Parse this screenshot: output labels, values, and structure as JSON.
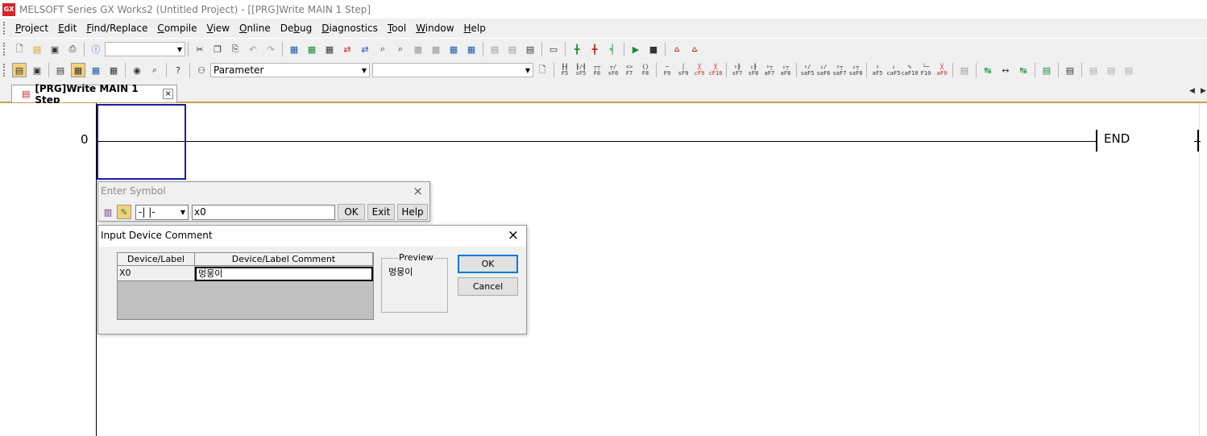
{
  "window": {
    "app_icon_text": "GX",
    "title": "MELSOFT Series GX Works2 (Untitled Project) - [[PRG]Write MAIN 1 Step]"
  },
  "menu": [
    {
      "label": "Project",
      "key": "P"
    },
    {
      "label": "Edit",
      "key": "E"
    },
    {
      "label": "Find/Replace",
      "key": "F"
    },
    {
      "label": "Compile",
      "key": "C"
    },
    {
      "label": "View",
      "key": "V"
    },
    {
      "label": "Online",
      "key": "O"
    },
    {
      "label": "Debug",
      "key": "b"
    },
    {
      "label": "Diagnostics",
      "key": "D"
    },
    {
      "label": "Tool",
      "key": "T"
    },
    {
      "label": "Window",
      "key": "W"
    },
    {
      "label": "Help",
      "key": "H"
    }
  ],
  "toolbar2": {
    "parameter_combo": "Parameter",
    "second_combo": ""
  },
  "ladder_keys": [
    "F5",
    "sF5",
    "F6",
    "sF6",
    "F7",
    "F8",
    "F9",
    "sF9",
    "cF9",
    "cF10",
    "sF7",
    "sF8",
    "aF7",
    "aF8",
    "saF5",
    "saF6",
    "saF7",
    "saF8",
    "aF5",
    "caF5",
    "caF10",
    "F10",
    "aF9"
  ],
  "tab": {
    "label": "[PRG]Write MAIN 1 Step",
    "close": "×",
    "scroll_left": "◀",
    "scroll_right": "▶"
  },
  "ladder": {
    "step_number": "0",
    "end_label": "END"
  },
  "enter_symbol": {
    "title": "Enter Symbol",
    "close": "×",
    "symbol_select": "-| |-",
    "device_input": "x0",
    "ok": "OK",
    "exit": "Exit",
    "help": "Help"
  },
  "comment_dialog": {
    "title": "Input Device Comment",
    "close": "×",
    "col_device": "Device/Label",
    "col_comment": "Device/Label Comment",
    "row_device": "X0",
    "row_comment": "멍뭉이",
    "preview_legend": "Preview",
    "preview_text": "멍뭉이",
    "ok": "OK",
    "cancel": "Cancel"
  },
  "colors": {
    "cursor": "#1a1aa8",
    "tab_underline": "#c4a050",
    "default_button_border": "#0078d7"
  }
}
